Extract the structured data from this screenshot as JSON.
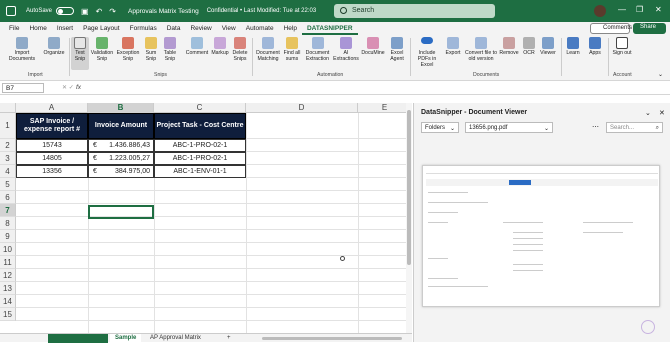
{
  "titlebar": {
    "autosave_label": "AutoSave",
    "autosave_state": "Off",
    "doc_title": "Approvals Matrix Testing",
    "status": "Confidential • Last Modified: Tue at 22:03",
    "search_placeholder": "Search"
  },
  "menu": {
    "tabs": [
      "File",
      "Home",
      "Insert",
      "Page Layout",
      "Formulas",
      "Data",
      "Review",
      "View",
      "Automate",
      "Help",
      "DATASNIPPER"
    ],
    "active": "DATASNIPPER",
    "comments_label": "Comments",
    "share_label": "Share"
  },
  "ribbon": {
    "buttons": [
      "Import Documents",
      "Organize",
      "Text Snip",
      "Validation Snip",
      "Exception Snip",
      "Sum Snip",
      "Table Snip",
      "Comment",
      "Markup",
      "Delete Snips",
      "Document Matching",
      "Find all sums",
      "Document Extraction",
      "AI Extractions",
      "DocuMine",
      "Excel Agent",
      "Include PDFs in Excel",
      "Export",
      "Convert file to old version",
      "Remove",
      "OCR",
      "Viewer",
      "Learn",
      "Apps",
      "Sign out"
    ],
    "groups": [
      "Import",
      "Snips",
      "Automation",
      "Documents",
      "Account"
    ]
  },
  "formula_bar": {
    "name_box": "B7",
    "fx": "fx"
  },
  "sheet": {
    "columns": [
      "A",
      "B",
      "C",
      "D",
      "E"
    ],
    "rows": [
      "1",
      "2",
      "3",
      "4",
      "5",
      "6",
      "7",
      "8",
      "9",
      "10",
      "11",
      "12",
      "13",
      "14",
      "15"
    ],
    "headers": [
      "SAP Invoice / expense report #",
      "Invoice Amount",
      "Project Task - Cost Centre"
    ],
    "data": [
      {
        "invoice": "15743",
        "currency": "€",
        "amount": "1.436.886,43",
        "task": "ABC-1-PRO-02-1"
      },
      {
        "invoice": "14805",
        "currency": "€",
        "amount": "1.223.005,27",
        "task": "ABC-1-PRO-02-1"
      },
      {
        "invoice": "13356",
        "currency": "€",
        "amount": "384.975,00",
        "task": "ABC-1-ENV-01-1"
      }
    ],
    "selected_cell": "B7"
  },
  "sheet_tabs": [
    "Sample",
    "AP Approval Matrix"
  ],
  "datasnipper": {
    "title": "DataSnipper - Document Viewer",
    "folder": "Folders",
    "file": "13656.png.pdf",
    "search_placeholder": "Search..."
  },
  "colors": {
    "excel_green": "#1e6e42",
    "header_navy": "#0f1e3c"
  }
}
